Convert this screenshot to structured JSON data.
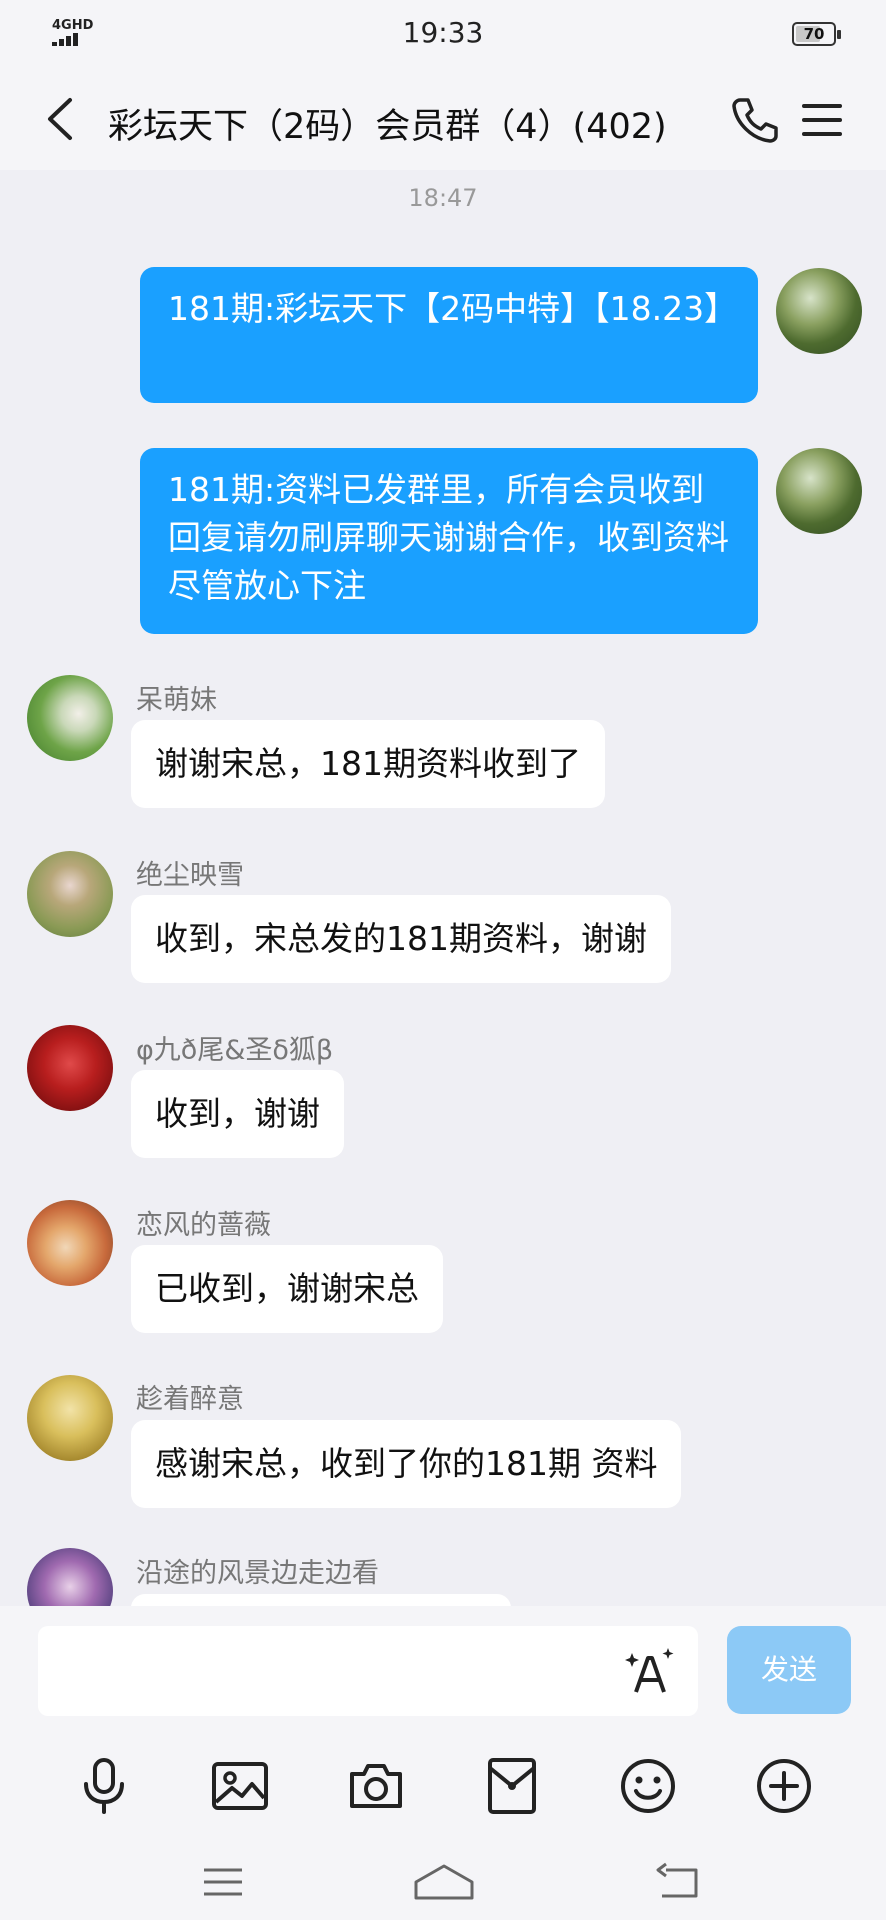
{
  "status_bar": {
    "network": "4GHD",
    "time": "19:33",
    "battery": "70",
    "battery_level": 0.7
  },
  "header": {
    "title": "彩坛天下（2码）会员群（4）(402)"
  },
  "chat": {
    "timestamp": "18:47",
    "outgoing": [
      {
        "text": "181期:彩坛天下【2码中特】【18.23】"
      },
      {
        "text": "181期:资料已发群里，所有会员收到回复请勿刷屏聊天谢谢合作，收到资料尽管放心下注"
      }
    ],
    "incoming": [
      {
        "sender": "呆萌妹",
        "text": "谢谢宋总，181期资料收到了"
      },
      {
        "sender": "绝尘映雪",
        "text": "收到，宋总发的181期资料，谢谢"
      },
      {
        "sender": "φ九ð尾&圣δ狐β",
        "text": "收到，谢谢"
      },
      {
        "sender": "恋风的蔷薇",
        "text": "已收到，谢谢宋总"
      },
      {
        "sender": "趁着醉意",
        "text": "感谢宋总，收到了你的181期 资料"
      },
      {
        "sender": "沿途的风景边走边看",
        "text": ""
      }
    ]
  },
  "input": {
    "value": "",
    "send_label": "发送"
  },
  "toolbar_icons": [
    "microphone-icon",
    "image-icon",
    "camera-icon",
    "red-packet-icon",
    "emoji-icon",
    "plus-icon"
  ],
  "colors": {
    "outgoing_bubble": "#1aa0ff",
    "send_button": "#8cc9f6",
    "background": "#efeff4"
  }
}
